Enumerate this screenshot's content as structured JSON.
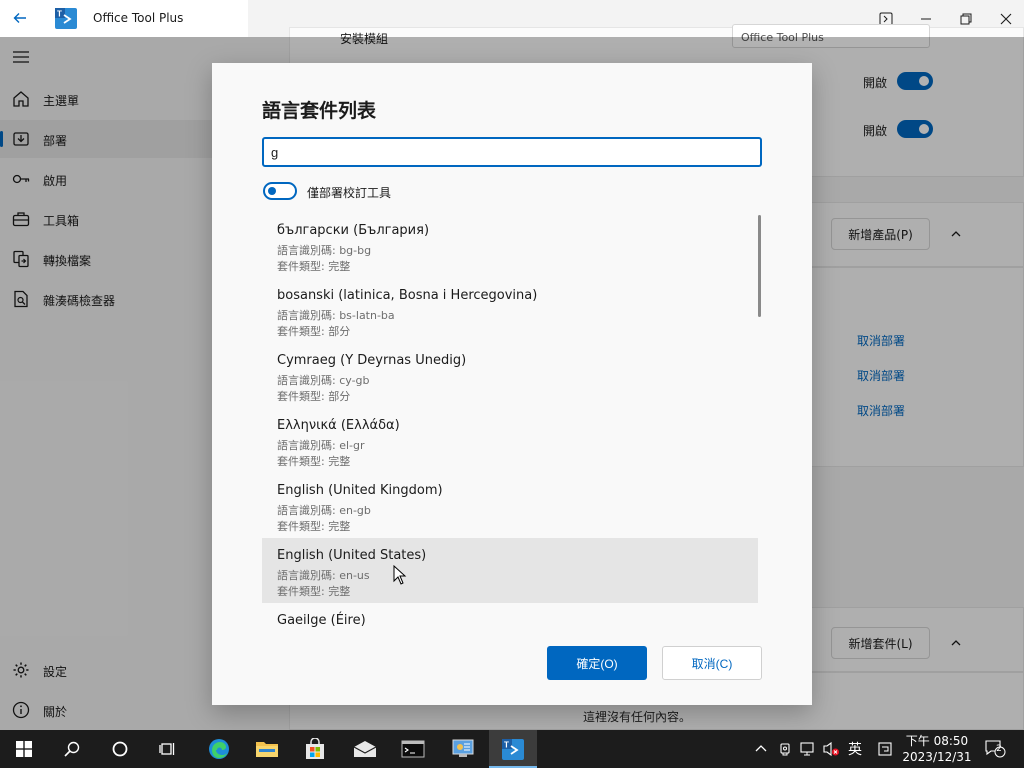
{
  "app": {
    "title": "Office Tool Plus"
  },
  "sidebar": {
    "items": [
      {
        "label": "主選單",
        "icon": "home-icon"
      },
      {
        "label": "部署",
        "icon": "deploy-icon",
        "active": true
      },
      {
        "label": "啟用",
        "icon": "key-icon"
      },
      {
        "label": "工具箱",
        "icon": "toolbox-icon"
      },
      {
        "label": "轉換檔案",
        "icon": "convert-icon"
      },
      {
        "label": "雜湊碼檢查器",
        "icon": "hash-icon"
      }
    ],
    "footer": [
      {
        "label": "設定",
        "icon": "gear-icon"
      },
      {
        "label": "關於",
        "icon": "info-icon"
      }
    ]
  },
  "background": {
    "partial_label": "安裝模組",
    "partial_field": "Office Tool Plus",
    "toggle_label_1": "開啟",
    "toggle_label_2": "開啟",
    "add_product_button": "新增產品(P)",
    "remove_links": [
      "取消部署",
      "取消部署",
      "取消部署"
    ],
    "add_package_button": "新增套件(L)",
    "empty_note": "這裡沒有任何內容。"
  },
  "dialog": {
    "title": "語言套件列表",
    "search_value": "g",
    "toggle_label": "僅部署校訂工具",
    "languages": [
      {
        "name": "български (България)",
        "code": "語言識別碼: bg-bg",
        "type": "套件類型: 完整"
      },
      {
        "name": "bosanski (latinica, Bosna i Hercegovina)",
        "code": "語言識別碼: bs-latn-ba",
        "type": "套件類型: 部分"
      },
      {
        "name": "Cymraeg (Y Deyrnas Unedig)",
        "code": "語言識別碼: cy-gb",
        "type": "套件類型: 部分"
      },
      {
        "name": "Ελληνικά (Ελλάδα)",
        "code": "語言識別碼: el-gr",
        "type": "套件類型: 完整"
      },
      {
        "name": "English (United Kingdom)",
        "code": "語言識別碼: en-gb",
        "type": "套件類型: 完整"
      },
      {
        "name": "English (United States)",
        "code": "語言識別碼: en-us",
        "type": "套件類型: 完整",
        "hover": true
      },
      {
        "name": "Gaeilge (Éire)",
        "code": "",
        "type": ""
      }
    ],
    "ok_label": "確定(O)",
    "cancel_label": "取消(C)"
  },
  "taskbar": {
    "ime": "英",
    "time": "下午 08:50",
    "date": "2023/12/31",
    "notification_count": "2"
  },
  "colors": {
    "accent": "#0067c0",
    "taskbar": "#1c1c1c"
  }
}
